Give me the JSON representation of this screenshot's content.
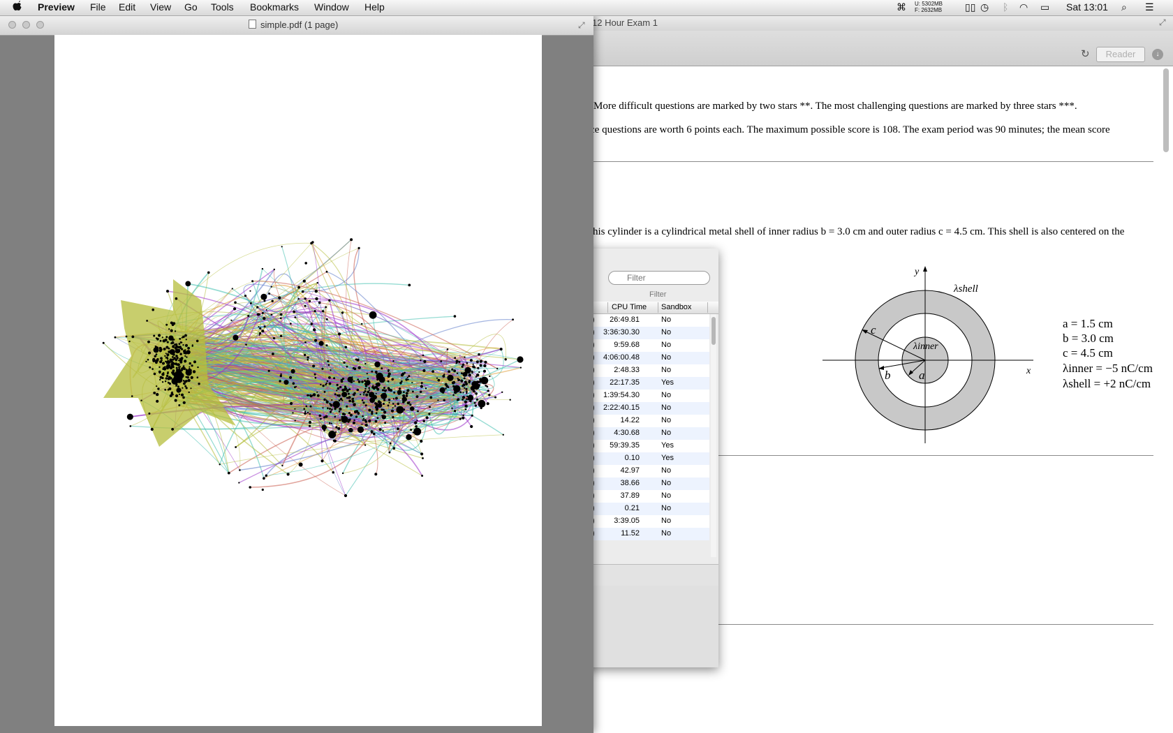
{
  "menubar": {
    "app": "Preview",
    "items": [
      "File",
      "Edit",
      "View",
      "Go",
      "Tools",
      "Bookmarks",
      "Window",
      "Help"
    ],
    "memory": {
      "used": "U: 5302MB",
      "free": "F: 2632MB"
    },
    "clock": "Sat 13:01"
  },
  "preview": {
    "title": "simple.pdf (1 page)"
  },
  "browser": {
    "title": "12 Hour Exam 1",
    "reader_label": "Reader",
    "paragraphs": [
      "*. More difficult questions are marked by two stars **. The most challenging questions are marked by three stars ***.",
      "ce questions are worth 6 points each. The maximum possible score is 108. The exam period was 90 minutes; the mean score",
      "his cylinder is a cylindrical metal shell of inner radius b = 3.0 cm and outer radius c = 4.5 cm. This shell is also centered on the"
    ],
    "figure": {
      "axis_x": "x",
      "axis_y": "y",
      "label_shell": "λshell",
      "label_inner": "λinner",
      "label_a": "a",
      "label_b": "b",
      "label_c": "c"
    },
    "equations": [
      "a  = 1.5 cm",
      "b = 3.0 cm",
      "c = 4.5 cm",
      "λinner = −5 nC/cm",
      "λshell = +2 nC/cm"
    ]
  },
  "activity_monitor": {
    "filter_placeholder": "Filter",
    "filter_caption": "Filter",
    "columns": {
      "cpu_time": "CPU Time",
      "sandbox": "Sandbox"
    },
    "rows": [
      {
        "cpu": "26:49.81",
        "sandbox": "No"
      },
      {
        "cpu": "3:36:30.30",
        "sandbox": "No"
      },
      {
        "cpu": "9:59.68",
        "sandbox": "No"
      },
      {
        "cpu": "4:06:00.48",
        "sandbox": "No"
      },
      {
        "cpu": "2:48.33",
        "sandbox": "No"
      },
      {
        "cpu": "22:17.35",
        "sandbox": "Yes"
      },
      {
        "cpu": "1:39:54.30",
        "sandbox": "No"
      },
      {
        "cpu": "2:22:40.15",
        "sandbox": "No"
      },
      {
        "cpu": "14.22",
        "sandbox": "No"
      },
      {
        "cpu": "4:30.68",
        "sandbox": "No"
      },
      {
        "cpu": "59:39.35",
        "sandbox": "Yes"
      },
      {
        "cpu": "0.10",
        "sandbox": "Yes"
      },
      {
        "cpu": "42.97",
        "sandbox": "No"
      },
      {
        "cpu": "38.66",
        "sandbox": "No"
      },
      {
        "cpu": "37.89",
        "sandbox": "No"
      },
      {
        "cpu": "0.21",
        "sandbox": "No"
      },
      {
        "cpu": "3:39.05",
        "sandbox": "No"
      },
      {
        "cpu": "11.52",
        "sandbox": "No"
      }
    ]
  },
  "graph": {
    "cluster_colors": [
      "#b5bd3c",
      "#9b30c8",
      "#3fbfae",
      "#c85a4a",
      "#5a78c8",
      "#e0a040"
    ]
  }
}
